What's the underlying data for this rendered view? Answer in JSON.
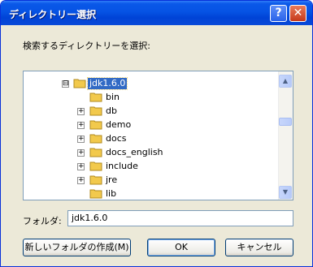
{
  "window": {
    "title": "ディレクトリー選択",
    "help_label": "?",
    "close_label": "✕"
  },
  "prompt": "検索するディレクトリーを選択:",
  "tree": {
    "items": [
      {
        "label": "jdk1.6.0",
        "expander": "⊟",
        "selected": true
      },
      {
        "label": "bin",
        "expander": ""
      },
      {
        "label": "db",
        "expander": "+"
      },
      {
        "label": "demo",
        "expander": "+"
      },
      {
        "label": "docs",
        "expander": "+"
      },
      {
        "label": "docs_english",
        "expander": "+"
      },
      {
        "label": "include",
        "expander": "+"
      },
      {
        "label": "jre",
        "expander": "+"
      },
      {
        "label": "lib",
        "expander": ""
      }
    ]
  },
  "scrollbar": {
    "up": "▲",
    "down": "▼"
  },
  "folder_field": {
    "label": "フォルダ:",
    "value": "jdk1.6.0"
  },
  "buttons": {
    "new_folder": "新しいフォルダの作成(M)",
    "ok": "OK",
    "cancel": "キャンセル"
  },
  "colors": {
    "titlebar": "#0653e4",
    "selection": "#316ac5",
    "folder": "#f2c94c"
  }
}
